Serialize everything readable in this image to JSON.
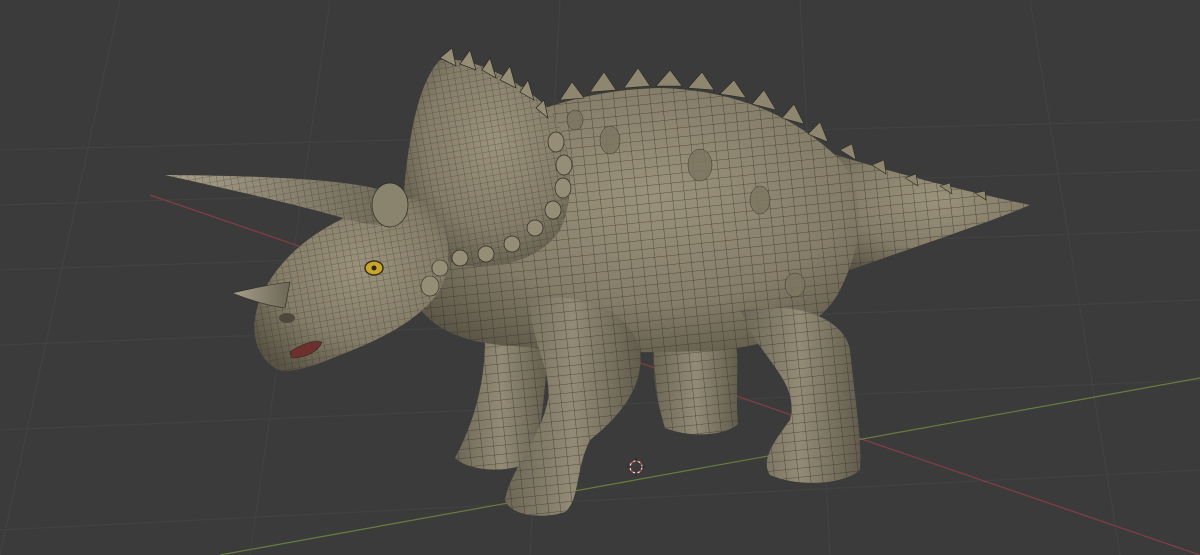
{
  "viewport": {
    "kind": "3d-viewport",
    "shading": "solid-wireframe-overlay",
    "subject": "triceratops",
    "background_color": "#3b3b3b",
    "grid_color": "#454545",
    "x_axis_color": "#9a3e48",
    "y_axis_color": "#6f8a3a",
    "mesh_wire_color": "#2a2a22",
    "skin_base_color": "#8a836e",
    "skin_shadow_color": "#5e584a",
    "eye_color": "#c8a62a",
    "mouth_color": "#6e2f2f",
    "object_origin_icon": "3d-cursor-icon"
  }
}
